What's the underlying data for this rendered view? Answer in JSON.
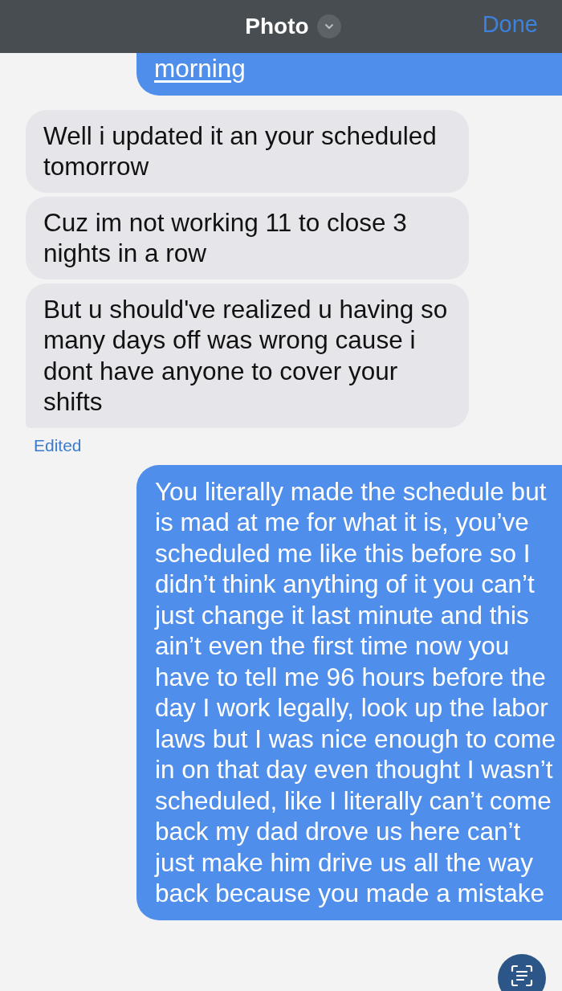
{
  "header": {
    "title": "Photo",
    "action": "Done"
  },
  "messages": [
    {
      "kind": "sent",
      "text": "morning",
      "link": true,
      "clipped": true
    },
    {
      "kind": "received",
      "text": "Well i updated it an your scheduled tomorrow"
    },
    {
      "kind": "received",
      "text": "Cuz im not working 11 to close 3 nights in a row"
    },
    {
      "kind": "received",
      "text": "But u should've realized u having so many days off was wrong cause i dont have anyone to cover your shifts",
      "tail": true
    },
    {
      "kind": "status",
      "text": "Edited"
    },
    {
      "kind": "sent",
      "text": "You literally made the schedule but is mad at me for what it is, you’ve scheduled me like this before so I didn’t think anything of it you can’t just change it last minute and this ain’t even the first time now you have to tell me 96 hours before the day I work legally, look up the labor laws but I was nice enough to come in on that day even thought I wasn’t scheduled, like I literally can’t come back my dad drove us here can’t just make him drive us all the way back because you made a mistake",
      "live_text": true
    }
  ]
}
